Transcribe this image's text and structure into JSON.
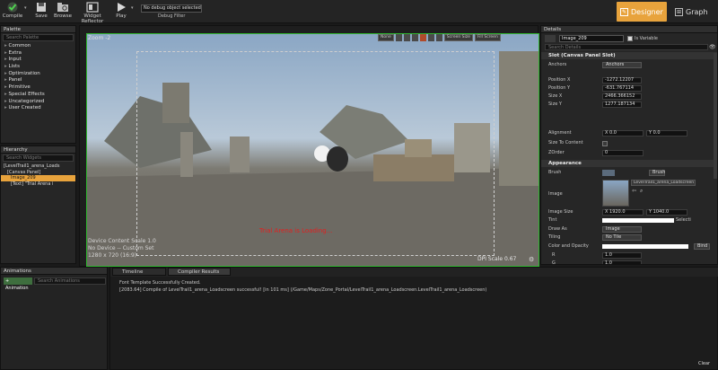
{
  "toolbar": {
    "buttons": [
      {
        "label": "Compile",
        "icon": "compile-check-icon"
      },
      {
        "label": "Save",
        "icon": "save-icon"
      },
      {
        "label": "Browse",
        "icon": "browse-icon"
      },
      {
        "label": "Widget Reflector",
        "icon": "widget-reflector-icon"
      },
      {
        "label": "Play",
        "icon": "play-icon"
      }
    ],
    "debug_dropdown": "No debug object selected",
    "debug_filter_label": "Debug Filter",
    "designer_label": "Designer",
    "graph_label": "Graph",
    "accent": "#e8a33c"
  },
  "palette": {
    "title": "Palette",
    "search_placeholder": "Search Palette",
    "items": [
      "Common",
      "Extra",
      "Input",
      "Lists",
      "Optimization",
      "Panel",
      "Primitive",
      "Special Effects",
      "Uncategorized",
      "User Created"
    ]
  },
  "hierarchy": {
    "title": "Hierarchy",
    "search_placeholder": "Search Widgets",
    "items": [
      {
        "label": "[LevelTrail1_arena_Loads",
        "indent": 0,
        "selected": false
      },
      {
        "label": "[Canvas Panel]",
        "indent": 1,
        "selected": false
      },
      {
        "label": "Image_209",
        "indent": 2,
        "selected": true
      },
      {
        "label": "[Text] \"Trial Arena i",
        "indent": 2,
        "selected": false
      }
    ]
  },
  "viewport": {
    "zoom_label": "Zoom -2",
    "toolbar": [
      "None",
      "Screen Size",
      "Fill Screen"
    ],
    "overlay_text": "Trial Arena is Loading...",
    "device_lines": [
      "Device Content Scale 1.0",
      "No Device -- Custom Set",
      "1280 x 720 (16:9)"
    ],
    "dpi_label": "DPI Scale 0.67",
    "green": "#2fb62f",
    "overlay_color": "#e02020"
  },
  "details": {
    "title": "Details",
    "name_value": "Image_209",
    "is_variable_label": "Is Variable",
    "search_placeholder": "Search Details",
    "slot_section": "Slot (Canvas Panel Slot)",
    "anchors_label": "Anchors",
    "anchors_value": "Anchors",
    "rows": [
      {
        "label": "Position X",
        "value": "-1272.12207"
      },
      {
        "label": "Position Y",
        "value": "-631.767114"
      },
      {
        "label": "Size X",
        "value": "2466.366152"
      },
      {
        "label": "Size Y",
        "value": "1277.187134"
      }
    ],
    "alignment_label": "Alignment",
    "alignment_x": "X  0.0",
    "alignment_y": "Y  0.0",
    "size_to_content_label": "Size To Content",
    "zorder_label": "ZOrder",
    "zorder_value": "0",
    "appearance_section": "Appearance",
    "brush_label": "Brush",
    "brush_dropdown": "Brush",
    "image_label": "Image",
    "image_value": "LevelTrail1_arena_LoadscreenT",
    "image_size_label": "Image Size",
    "image_size_x": "X  1920.0",
    "image_size_y": "Y  1040.0",
    "tint_label": "Tint",
    "tint_extra": "Selecti",
    "draw_as_label": "Draw As",
    "draw_as_value": "Image",
    "tiling_label": "Tiling",
    "tiling_value": "No Tile",
    "color_opacity_label": "Color and Opacity",
    "bind_label": "Bind",
    "channels": [
      {
        "label": "R",
        "value": "1.0"
      },
      {
        "label": "G",
        "value": "1.0"
      },
      {
        "label": "B",
        "value": "1.0"
      },
      {
        "label": "A",
        "value": "1.0"
      }
    ]
  },
  "bottom": {
    "animations_title": "Animations",
    "animation_button": "+ Animation",
    "search_animations": "Search Animations",
    "timeline_tab": "Timeline",
    "compiler_tab": "Compiler Results",
    "log": [
      "Font Template Successfully Created.",
      "[2083.64] Compile of LevelTrail1_arena_Loadscreen successful! [in 101 ms] (/Game/Maps/Zone_Portal/LevelTrail1_arena_Loadscreen.LevelTrail1_arena_Loadscreen)"
    ],
    "clear_label": "Clear"
  }
}
